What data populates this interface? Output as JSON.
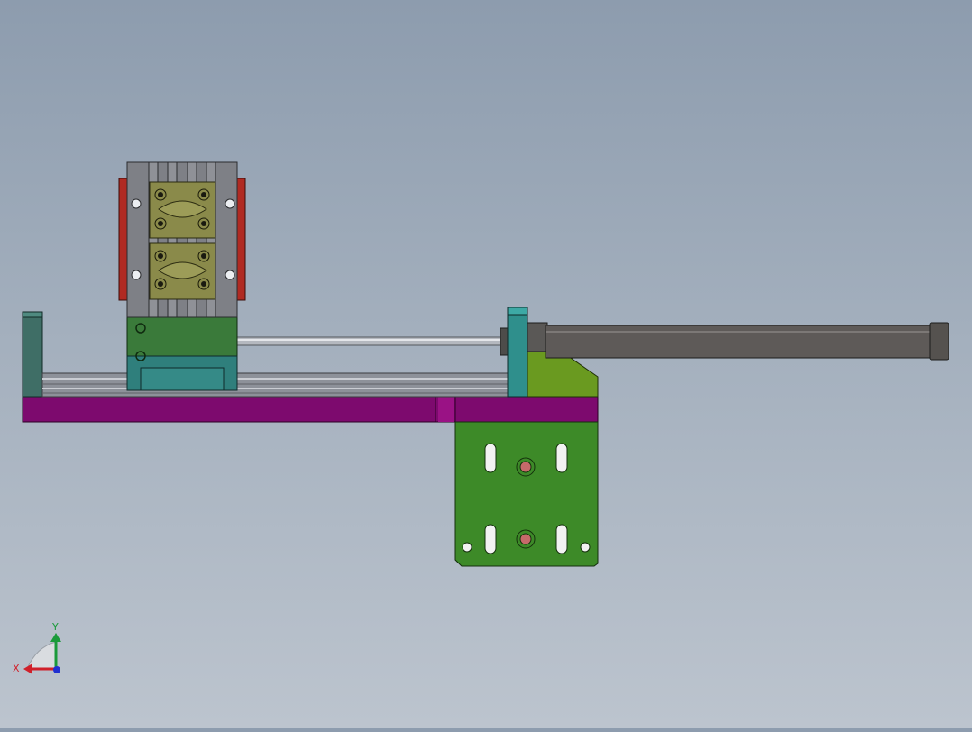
{
  "view": {
    "background_top": "#8d9cae",
    "background_bottom": "#bcc4ce"
  },
  "axis_triad": {
    "x_label": "X",
    "y_label": "Y",
    "x_color": "#d0202a",
    "y_color": "#1a9a3a",
    "z_color": "#2030d0"
  },
  "model": {
    "colors": {
      "base_plate": "#7d0a6e",
      "mount_bracket": "#3d8a28",
      "cylinder_body": "#5e5a58",
      "end_support": "#2f8f8c",
      "rail": "#9a9ea6",
      "gripper_frame": "#7e8086",
      "gripper_jaw": "#8a8a4a",
      "side_plate": "#b02a22",
      "carriage": "#3a7a3a",
      "gusset": "#6a9a20"
    }
  }
}
